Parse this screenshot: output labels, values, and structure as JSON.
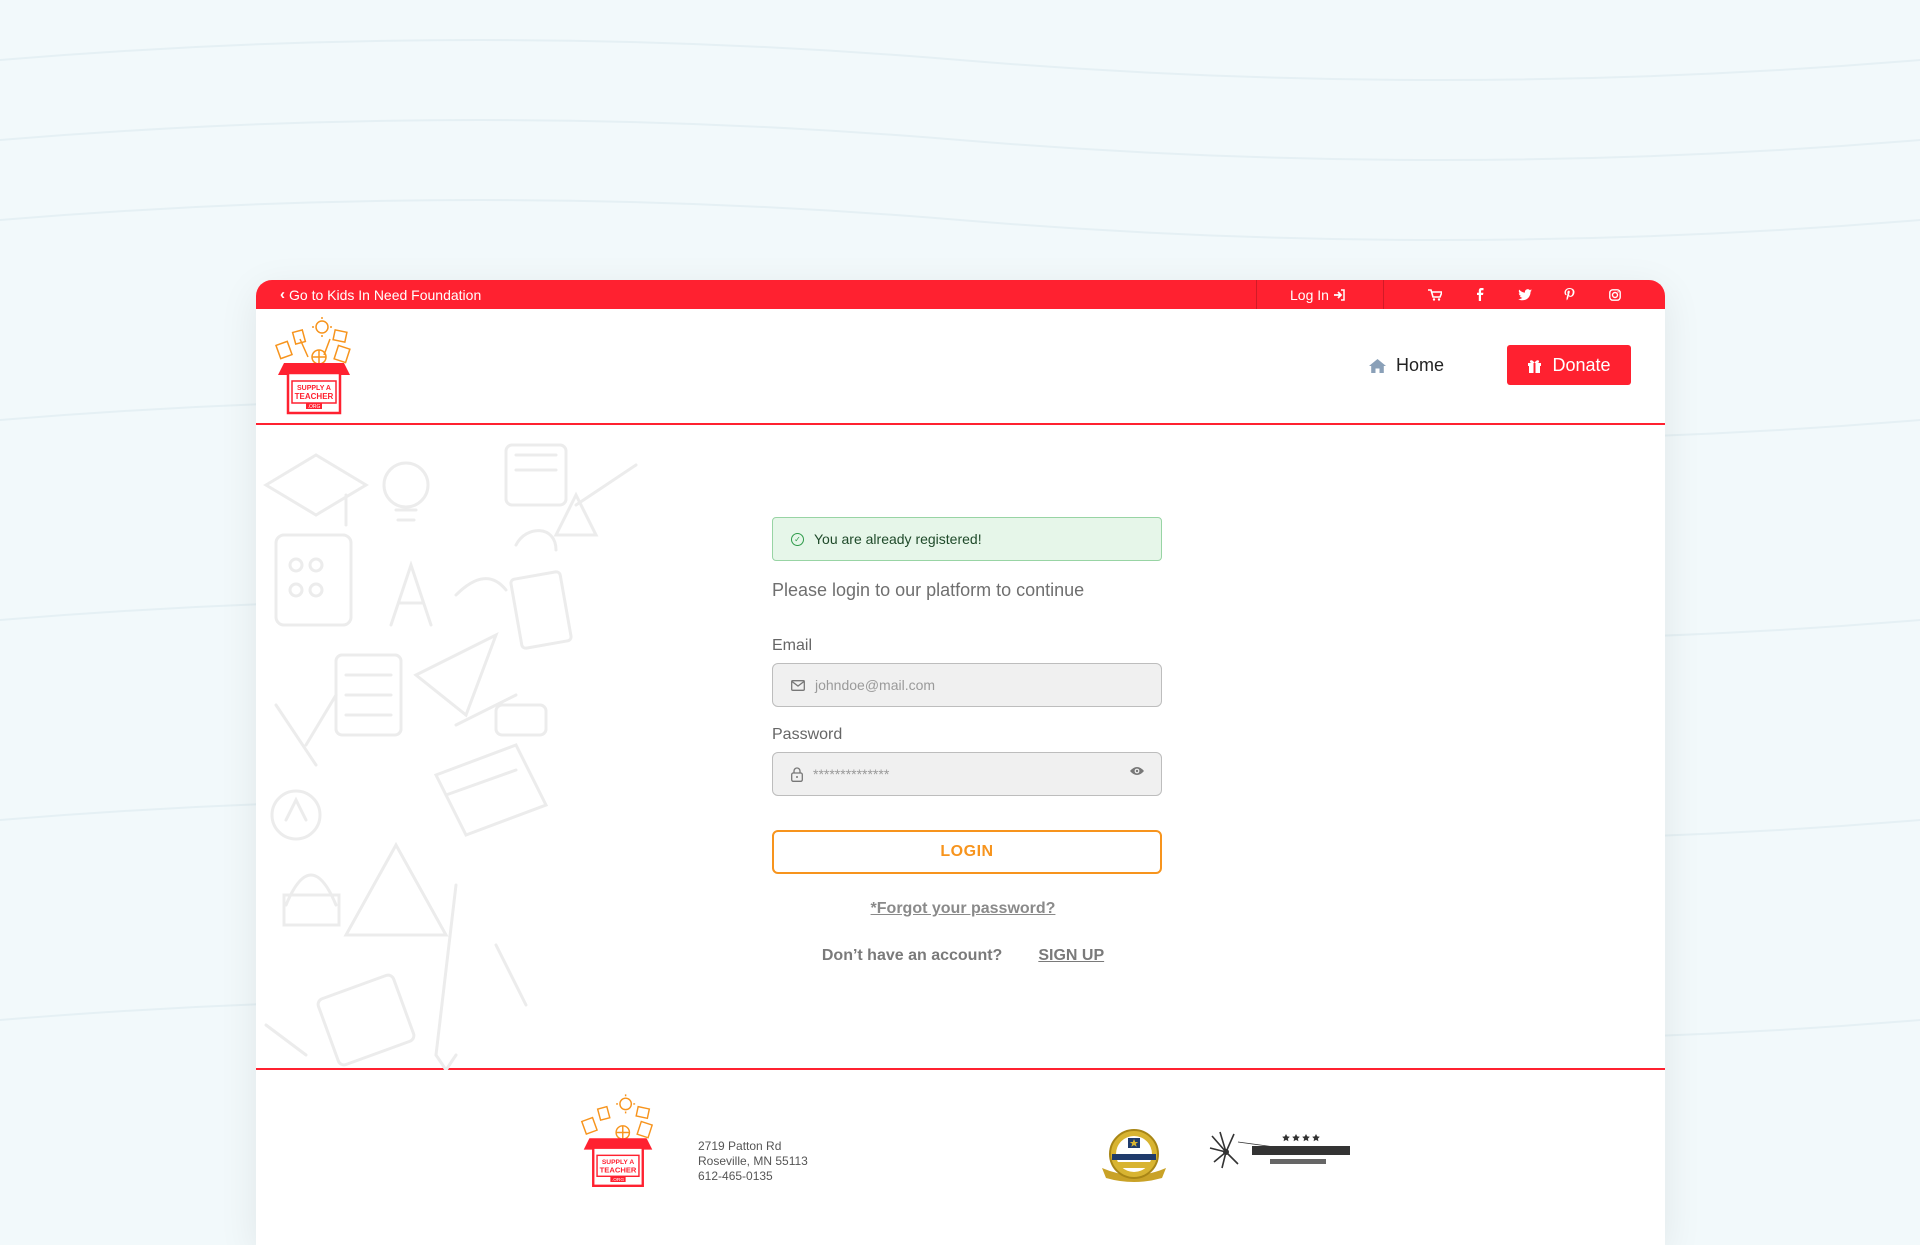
{
  "topbar": {
    "back_label": "Go to Kids In Need Foundation",
    "login_label": "Log In",
    "social_icons": [
      "cart-icon",
      "facebook-icon",
      "twitter-icon",
      "pinterest-icon",
      "instagram-icon"
    ]
  },
  "header": {
    "logo_icon": "supply-a-teacher-logo",
    "nav_home_label": "Home",
    "donate_label": "Donate"
  },
  "main": {
    "alert_text": "You are already registered!",
    "subtitle": "Please login to our platform to continue",
    "email_label": "Email",
    "email_placeholder": "johndoe@mail.com",
    "password_label": "Password",
    "password_value": "**************",
    "login_button": "LOGIN",
    "forgot_link": "*Forgot your password?",
    "no_account_text": "Don’t have an account?",
    "signup_link": "SIGN UP"
  },
  "footer": {
    "address_line1": "2719 Patton Rd",
    "address_line2": "Roseville, MN 55113",
    "phone": "612-465-0135",
    "badges": [
      "guidestar-gold-badge",
      "charity-navigator-four-star-badge"
    ]
  },
  "colors": {
    "brand_red": "#ff2130",
    "accent_orange": "#f7941d",
    "success_green": "#2e9b4a",
    "page_bg": "#f2f9fb"
  }
}
